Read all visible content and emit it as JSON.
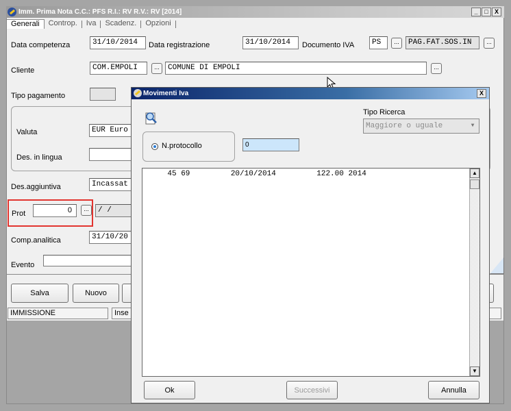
{
  "main_window": {
    "title": "Imm. Prima Nota C.C.: PFS R.I.: RV R.V.: RV [2014]",
    "controls": {
      "minimize": "_",
      "maximize": "□",
      "close": "X"
    },
    "tabs": [
      "Generali",
      "Controp.",
      "Iva",
      "Scadenz.",
      "Opzioni"
    ],
    "fields": {
      "data_competenza_label": "Data competenza",
      "data_competenza_value": "31/10/2014",
      "data_registrazione_label": "Data registrazione",
      "data_registrazione_value": "31/10/2014",
      "documento_iva_label": "Documento IVA",
      "documento_iva_code": "PS",
      "documento_iva_desc": "PAG.FAT.SOS.IN",
      "cliente_label": "Cliente",
      "cliente_code": "COM.EMPOLI",
      "cliente_name": "COMUNE DI EMPOLI",
      "tipo_pagamento_label": "Tipo pagamento",
      "valuta_label": "Valuta",
      "valuta_value": "EUR Euro",
      "des_lingua_label": "Des. in lingua",
      "des_aggiuntiva_label": "Des.aggiuntiva",
      "des_aggiuntiva_value": "Incassat",
      "prot_label": "Prot",
      "prot_value": "0",
      "prot_date": " /  /",
      "comp_analitica_label": "Comp.analitica",
      "comp_analitica_value": "31/10/20",
      "evento_label": "Evento"
    },
    "buttons": {
      "salva": "Salva",
      "nuovo": "Nuovo"
    },
    "status": {
      "mode": "IMMISSIONE",
      "insert": "Inse"
    },
    "dots_label": "..."
  },
  "dialog": {
    "title": "Movimenti Iva",
    "close": "X",
    "tipo_ricerca_label": "Tipo Ricerca",
    "tipo_ricerca_value": "Maggiore o uguale",
    "radio_label": "N.protocollo",
    "protocollo_value": "0",
    "list_rows": [
      "    45 69         20/10/2014         122.00 2014"
    ],
    "buttons": {
      "ok": "Ok",
      "successivi": "Successivi",
      "annulla": "Annulla"
    }
  }
}
